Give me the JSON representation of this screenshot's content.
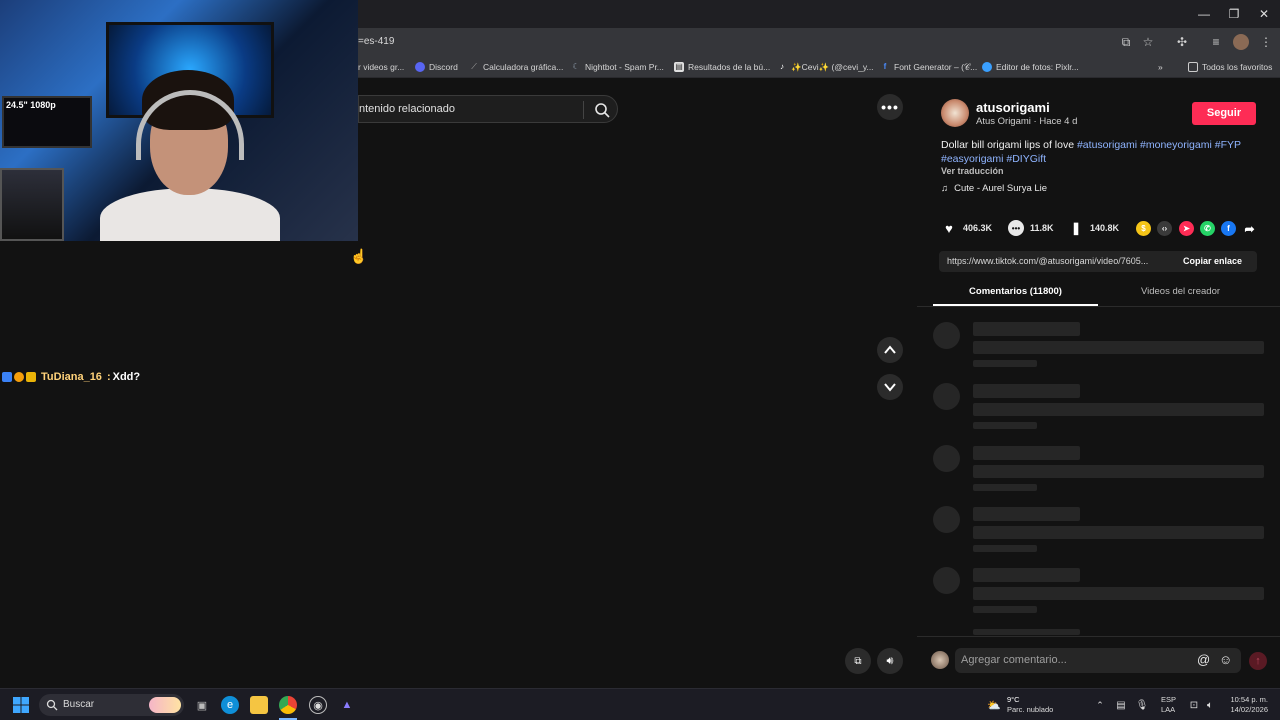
{
  "browser": {
    "url_partial": "=es-419",
    "bookmarks": [
      {
        "label": "r videos gr...",
        "icon": ""
      },
      {
        "label": "Discord",
        "icon": "discord-icon"
      },
      {
        "label": "Calculadora gráfica...",
        "icon": "desmos-icon"
      },
      {
        "label": "Nightbot - Spam Pr...",
        "icon": "nightbot-icon"
      },
      {
        "label": "Resultados de la bú...",
        "icon": "search-result-icon"
      },
      {
        "label": "✨Cevi✨ (@cevi_y...",
        "icon": "tiktok-icon"
      },
      {
        "label": "Font Generator – (𝒞...",
        "icon": "font-icon"
      },
      {
        "label": "Editor de fotos: Pixlr...",
        "icon": "pixlr-icon"
      }
    ],
    "all_bookmarks": "Todos los favoritos"
  },
  "webcam": {
    "monitor_label": "24.5\" 1080p"
  },
  "chat": {
    "user": "TuDiana_16",
    "separator": " : ",
    "message": "Xdd?"
  },
  "video_area": {
    "search_text": "ntenido relacionado"
  },
  "post": {
    "username": "atusorigami",
    "display_name": "Atus Origami",
    "time": "Hace 4 d",
    "separator": " · ",
    "follow_label": "Seguir",
    "description_text": "Dollar bill origami lips of love ",
    "tags": [
      "#atusorigami",
      "#moneyorigami",
      "#FYP",
      "#easyorigami",
      "#DIYGift"
    ],
    "translate_label": "Ver traducción",
    "music": "Cute - Aurel Surya Lie",
    "likes": "406.3K",
    "comments": "11.8K",
    "saves": "140.8K",
    "link": "https://www.tiktok.com/@atusorigami/video/7605...",
    "copy_label": "Copiar enlace",
    "tab_comments": "Comentarios (11800)",
    "tab_creator": "Videos del creador",
    "comment_placeholder": "Agregar comentario..."
  },
  "taskbar": {
    "search_label": "Buscar",
    "weather_temp": "9°C",
    "weather_desc": "Parc. nublado",
    "lang1": "ESP",
    "lang2": "LAA",
    "time": "10:54 p. m.",
    "date": "14/02/2026"
  },
  "colors": {
    "accent_follow": "#fe2c55",
    "tag_color": "#8fb4ff",
    "chat_user": "#ffd27a"
  }
}
